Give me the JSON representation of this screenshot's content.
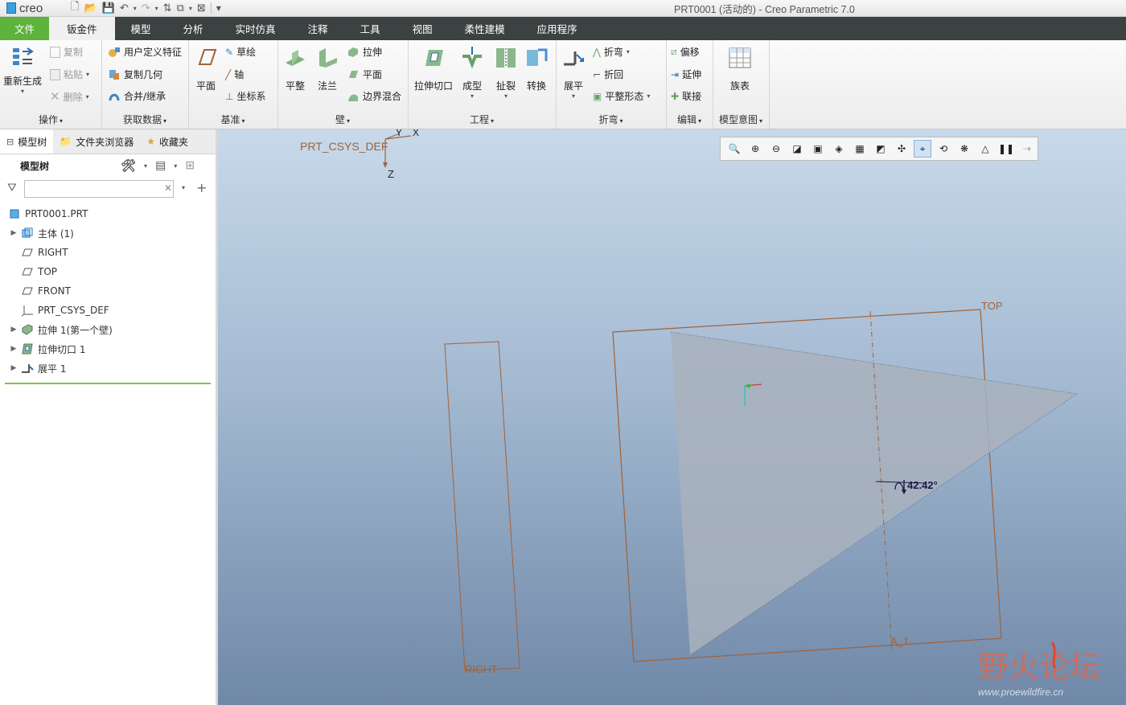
{
  "titlebar": {
    "app_logo": "creo",
    "title": "PRT0001 (活动的) - Creo Parametric 7.0"
  },
  "tabs": [
    {
      "label": "文件"
    },
    {
      "label": "钣金件"
    },
    {
      "label": "模型"
    },
    {
      "label": "分析"
    },
    {
      "label": "实时仿真"
    },
    {
      "label": "注释"
    },
    {
      "label": "工具"
    },
    {
      "label": "视图"
    },
    {
      "label": "柔性建模"
    },
    {
      "label": "应用程序"
    }
  ],
  "ribbon": {
    "operations": {
      "label": "操作",
      "regenerate": "重新生成",
      "copy": "复制",
      "paste": "粘贴",
      "delete": "删除"
    },
    "get_data": {
      "label": "获取数据",
      "udf": "用户定义特征",
      "copy_geom": "复制几何",
      "merge": "合并/继承"
    },
    "datum": {
      "label": "基准",
      "plane": "平面",
      "sketch": "草绘",
      "axis": "轴",
      "csys": "坐标系"
    },
    "wall": {
      "label": "壁",
      "flat": "平整",
      "flange": "法兰",
      "extrude": "拉伸",
      "planar": "平面",
      "boundary": "边界混合"
    },
    "engineering": {
      "label": "工程",
      "extrude_cut": "拉伸切口",
      "form": "成型",
      "rip": "扯裂",
      "convert": "转换"
    },
    "bend": {
      "label": "折弯",
      "unbend": "展平",
      "bend": "折弯",
      "bend_back": "折回",
      "flat_state": "平整形态"
    },
    "edit": {
      "label": "编辑",
      "offset": "偏移",
      "extend": "延伸",
      "join": "联接"
    },
    "model_intent": {
      "label": "模型意图",
      "family_table": "族表"
    }
  },
  "panel": {
    "tabs": [
      {
        "label": "模型树"
      },
      {
        "label": "文件夹浏览器"
      },
      {
        "label": "收藏夹"
      }
    ],
    "tree_title": "模型树",
    "filter_value": "",
    "items": [
      {
        "label": "PRT0001.PRT",
        "icon": "part-icon"
      },
      {
        "label": "主体 (1)",
        "icon": "body-icon"
      },
      {
        "label": "RIGHT",
        "icon": "datum-plane-icon"
      },
      {
        "label": "TOP",
        "icon": "datum-plane-icon"
      },
      {
        "label": "FRONT",
        "icon": "datum-plane-icon"
      },
      {
        "label": "PRT_CSYS_DEF",
        "icon": "csys-icon"
      },
      {
        "label": "拉伸 1(第一个壁)",
        "icon": "extrude-wall-icon"
      },
      {
        "label": "拉伸切口 1",
        "icon": "extrude-cut-icon"
      },
      {
        "label": "展平 1",
        "icon": "unbend-icon"
      }
    ]
  },
  "scene": {
    "csys_label": "PRT_CSYS_DEF",
    "axis_x": "X",
    "axis_y": "Y",
    "axis_z": "Z",
    "top_label": "TOP",
    "right_label": "RIGHT",
    "axis_label": "A_1",
    "angle_label": "42.42°",
    "colors": {
      "datum": "#a0623a",
      "sheet": "#a9b1bd"
    }
  },
  "watermark": {
    "main": "野火论坛",
    "url": "www.proewildfire.cn"
  }
}
